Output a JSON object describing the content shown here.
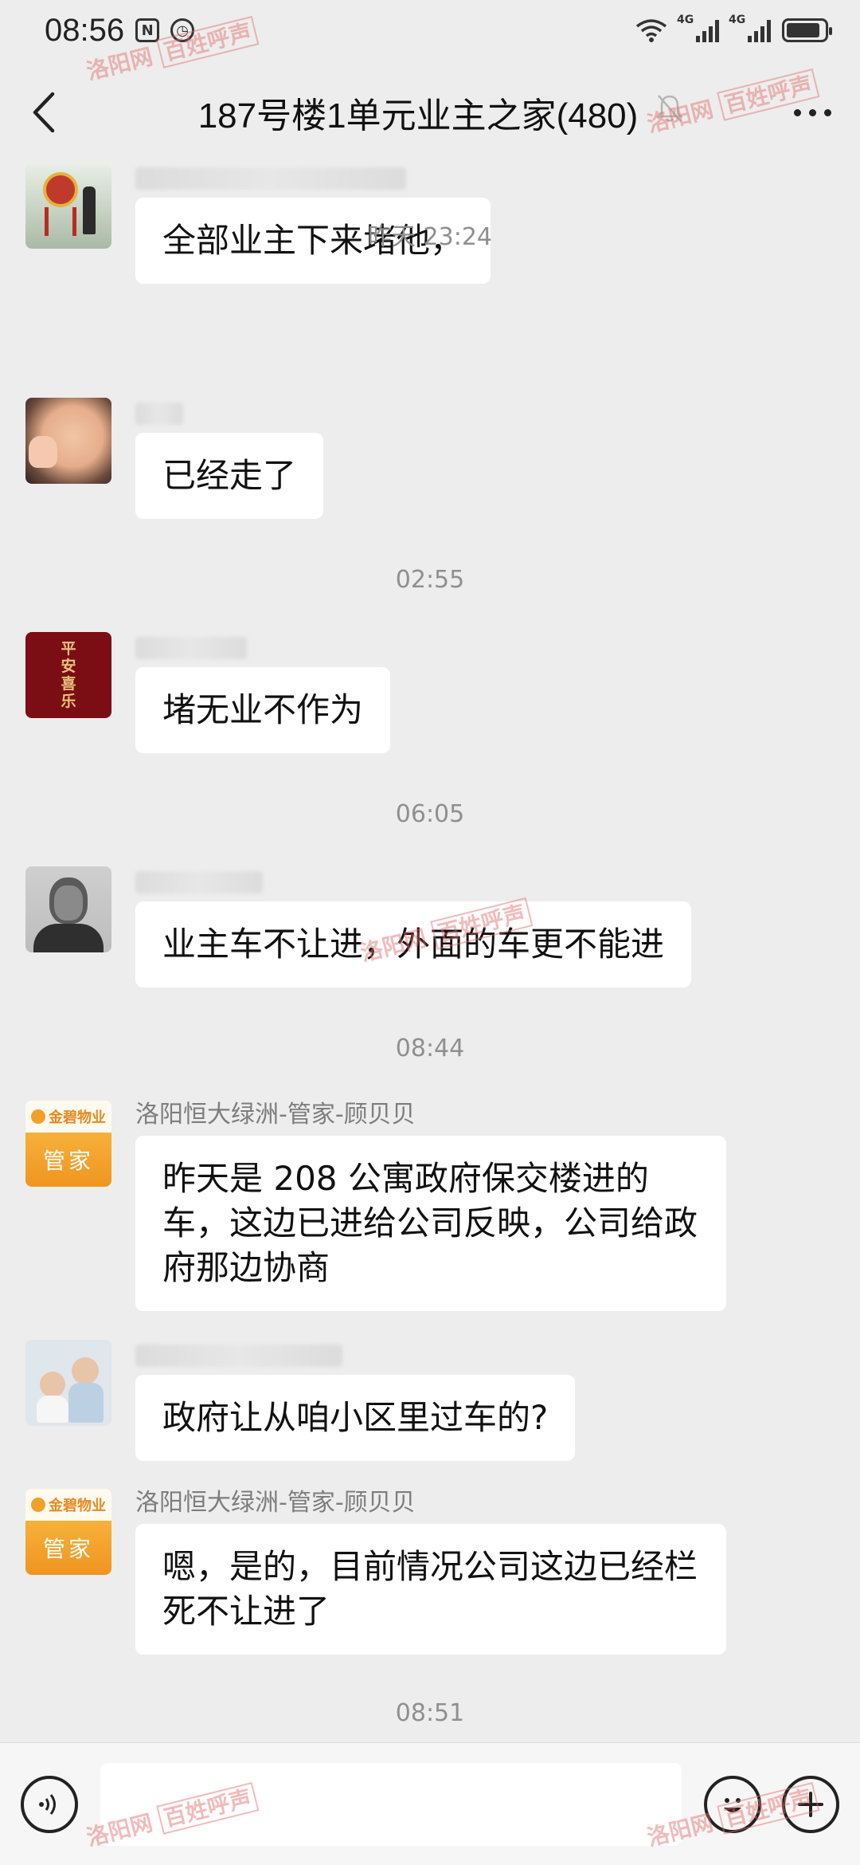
{
  "status_bar": {
    "time": "08:56",
    "icons": [
      "nfc-icon",
      "alarm-icon",
      "wifi-icon",
      "signal-4g-icon",
      "signal-4g-icon",
      "battery-icon"
    ],
    "network_label_1": "4G",
    "network_label_2": "4G",
    "battery_level": 0.9
  },
  "header": {
    "title": "187号楼1单元业主之家(480)",
    "muted": true
  },
  "watermark": {
    "site": "洛阳网",
    "tag": "百姓呼声"
  },
  "messages": [
    {
      "type": "message",
      "sender": "",
      "text": "全部业主下来堵他，",
      "avatar": "drum-avatar"
    },
    {
      "type": "time",
      "text": "昨天 23:24"
    },
    {
      "type": "message",
      "sender": "",
      "text": "已经走了",
      "avatar": "child-avatar"
    },
    {
      "type": "time",
      "text": "02:55"
    },
    {
      "type": "message",
      "sender": "",
      "text": "堵无业不作为",
      "avatar": "blessing-avatar",
      "avatar_text": [
        "平",
        "安",
        "喜",
        "乐"
      ]
    },
    {
      "type": "time",
      "text": "06:05"
    },
    {
      "type": "message",
      "sender": "",
      "text": "业主车不让进，外面的车更不能进",
      "avatar": "portrait-avatar"
    },
    {
      "type": "time",
      "text": "08:44"
    },
    {
      "type": "message",
      "sender": "洛阳恒大绿洲-管家-顾贝贝",
      "text": "昨天是 208 公寓政府保交楼进的车，这边已进给公司反映，公司给政府那边协商",
      "avatar": "butler-avatar",
      "avatar_brand": "金碧物业",
      "avatar_label": "管家"
    },
    {
      "type": "message",
      "sender": "",
      "text": "政府让从咱小区里过车的?",
      "avatar": "kids-avatar"
    },
    {
      "type": "message",
      "sender": "洛阳恒大绿洲-管家-顾贝贝",
      "text": "嗯，是的，目前情况公司这边已经栏死不让进了",
      "avatar": "butler-avatar",
      "avatar_brand": "金碧物业",
      "avatar_label": "管家"
    },
    {
      "type": "time",
      "text": "08:51"
    }
  ],
  "input_bar": {
    "voice_icon": "voice-icon",
    "emoji_icon": "emoji-icon",
    "plus_icon": "plus-icon"
  }
}
